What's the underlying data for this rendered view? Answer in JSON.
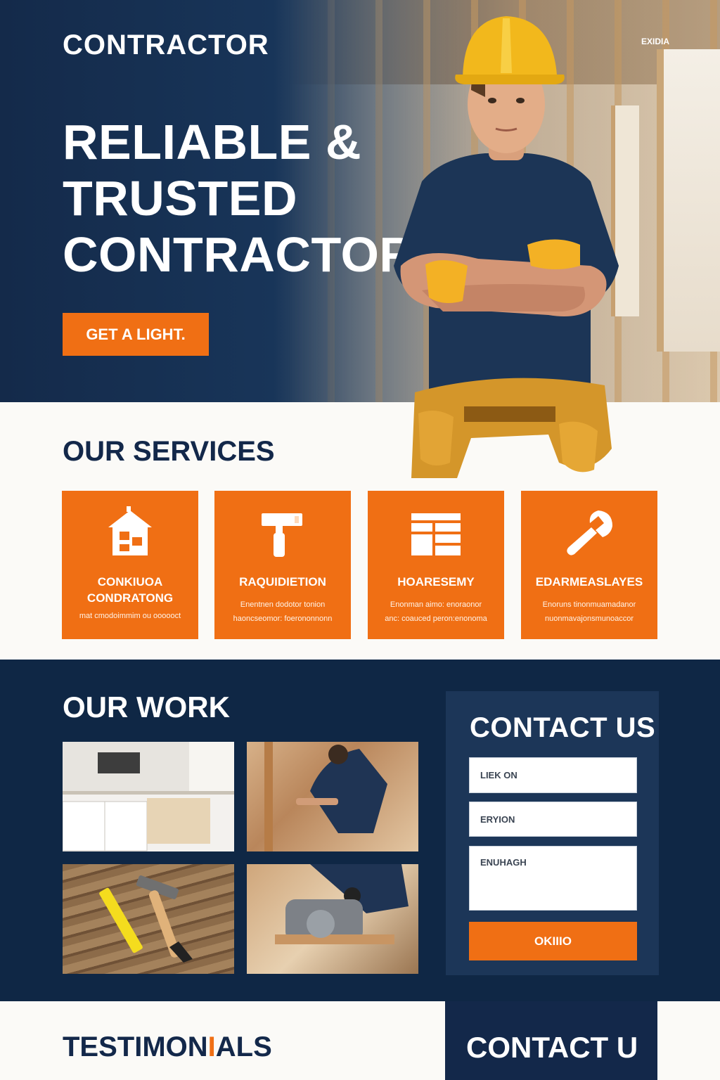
{
  "header": {
    "brand": "CONTRACTOR",
    "corner_tag": "EXIDIA"
  },
  "hero": {
    "title_lines": [
      "RELIABLE &",
      "TRUSTED",
      "CONTRACTOR"
    ],
    "cta_label": "GET A LIGHT."
  },
  "services": {
    "title": "OUR SERVICES",
    "items": [
      {
        "icon": "house-icon",
        "title": "CONKIUOA\nCONDRATONG",
        "desc": "mat cmodoimmim ou oooooct"
      },
      {
        "icon": "paint-roller-icon",
        "title": "RAQUIDIETION",
        "desc": "Enentnen dodotor tonion\nhaoncseomor: foerononnonn"
      },
      {
        "icon": "brick-wall-icon",
        "title": "HOARESEMY",
        "desc": "Enonman aimo: enoraonor\nanc: coauced peron:enonoma"
      },
      {
        "icon": "wrench-icon",
        "title": "EDARMEASLAYES",
        "desc": "Enoruns tinonmuamadanor\nnuonmavajonsmunoaccor"
      }
    ]
  },
  "work": {
    "title": "OUR WORK",
    "photos": [
      "kitchen-photo",
      "floor-install-photo",
      "hammer-photo",
      "saw-photo"
    ]
  },
  "contact": {
    "title": "CONTACT US",
    "field1_placeholder": "LIEK ON",
    "field2_placeholder": "ERYION",
    "field3_placeholder": "ENUHAGH",
    "submit_label": "OKIIIO"
  },
  "testimonials": {
    "title_start": "TESTIMON",
    "title_accent": "I",
    "title_end": "ALS"
  },
  "bottom_contact": {
    "title": "CONTACT U"
  },
  "colors": {
    "navy": "#0f2745",
    "navy_card": "#1c3658",
    "orange": "#f06f14",
    "cream": "#fbfaf7"
  }
}
